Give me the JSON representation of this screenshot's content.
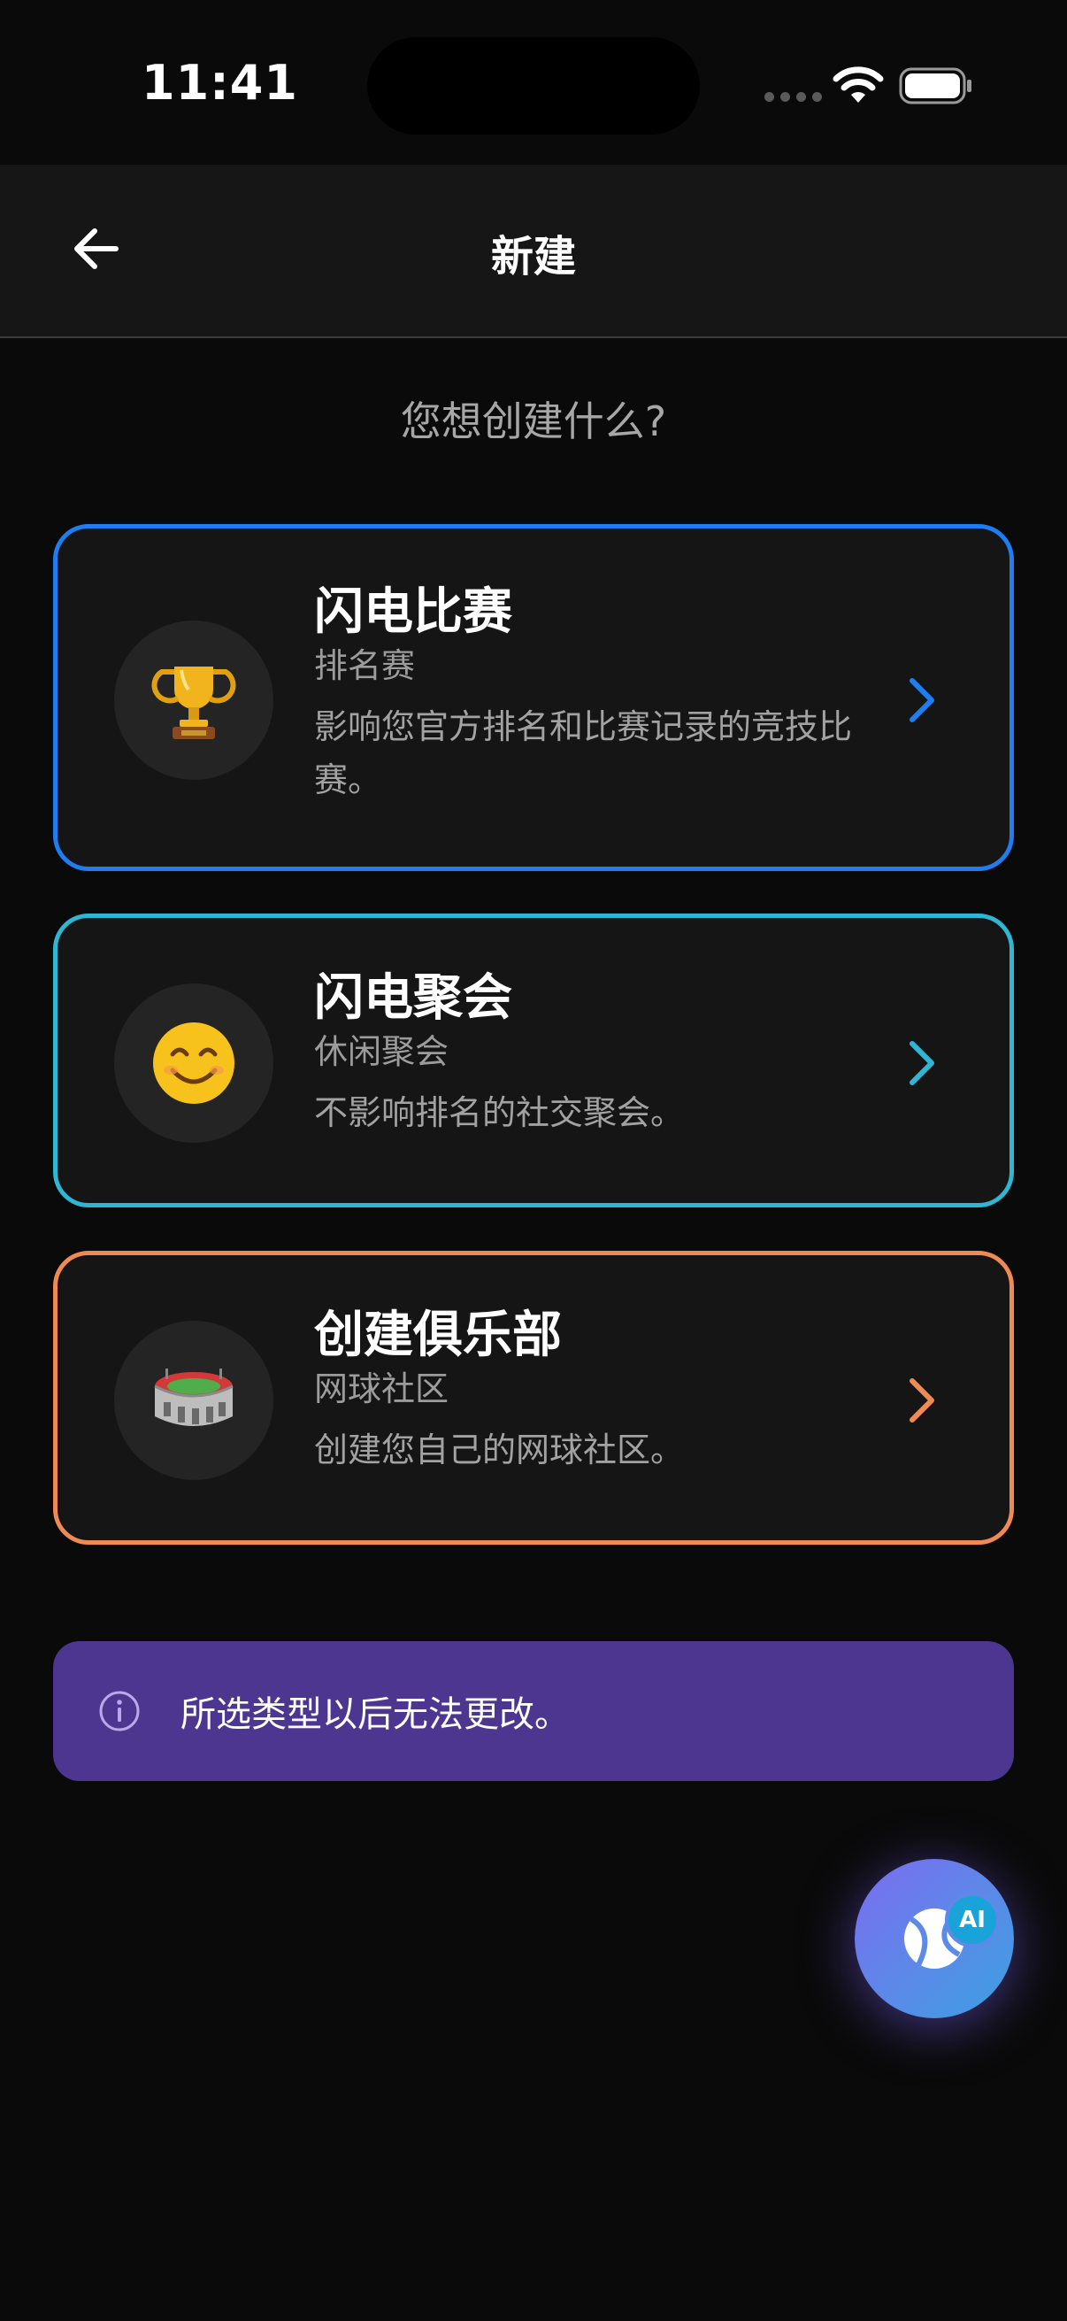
{
  "status_bar": {
    "time": "11:41"
  },
  "nav": {
    "title": "新建"
  },
  "prompt": "您想创建什么?",
  "options": [
    {
      "title": "闪电比赛",
      "subtitle": "排名赛",
      "description": "影响您官方排名和比赛记录的竞技比赛。",
      "icon": "trophy-icon",
      "accent_color": "#1e7df0"
    },
    {
      "title": "闪电聚会",
      "subtitle": "休闲聚会",
      "description": "不影响排名的社交聚会。",
      "icon": "smiley-face-icon",
      "accent_color": "#2fb6d3"
    },
    {
      "title": "创建俱乐部",
      "subtitle": "网球社区",
      "description": "创建您自己的网球社区。",
      "icon": "stadium-icon",
      "accent_color": "#f08a55"
    }
  ],
  "info_banner": {
    "text": "所选类型以后无法更改。",
    "icon": "info-icon"
  },
  "ai_button": {
    "badge": "AI",
    "icon": "tennis-ball-icon"
  }
}
